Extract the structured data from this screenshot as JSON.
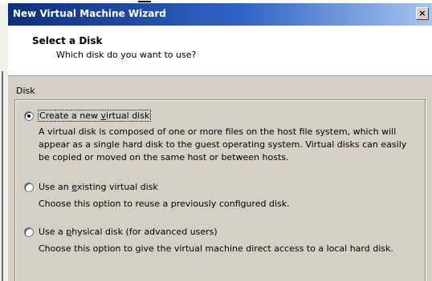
{
  "window": {
    "title": "New Virtual Machine Wizard",
    "close_label": "×"
  },
  "header": {
    "title": "Select a Disk",
    "subtitle": "Which disk do you want to use?"
  },
  "group": {
    "label": "Disk"
  },
  "options": [
    {
      "label_pre": "Create a new ",
      "label_key": "v",
      "label_post": "irtual disk",
      "selected": true,
      "description": "A virtual disk is composed of one or more files on the host file system, which will appear as a single hard disk to the guest operating system. Virtual disks can easily be copied or moved on the same host or between hosts."
    },
    {
      "label_pre": "Use an ",
      "label_key": "e",
      "label_post": "xisting virtual disk",
      "selected": false,
      "description": "Choose this option to reuse a previously configured disk."
    },
    {
      "label_pre": "Use a ",
      "label_key": "p",
      "label_post": "hysical disk (for advanced users)",
      "selected": false,
      "description": "Choose this option to give the virtual machine direct access to a local hard disk."
    }
  ]
}
